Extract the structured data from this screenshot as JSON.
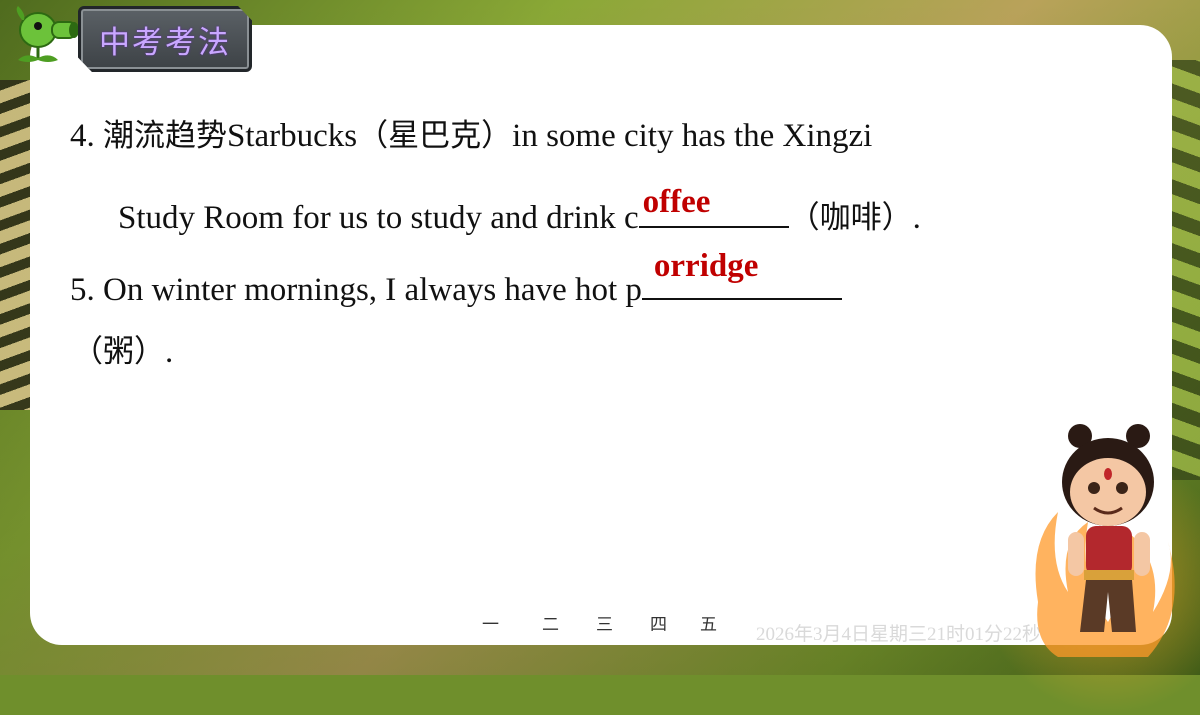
{
  "badge": {
    "title": "中考考法"
  },
  "questions": [
    {
      "number": "4.",
      "topic": "潮流趋势",
      "text_a": "Starbucks",
      "gloss_a": "（星巴克）",
      "text_b": "in some city has the Xingzi",
      "text_c": "Study Room for us to study and drink c",
      "answer": "offee",
      "gloss_b": "（咖啡）",
      "end": "."
    },
    {
      "number": "5.",
      "text_a": "On winter mornings, I always have hot p",
      "answer": "orridge",
      "gloss": "（粥）",
      "end": "."
    }
  ],
  "nav": [
    "一",
    "二",
    "三",
    "四",
    "五"
  ],
  "watermark": "2026年3月4日星期三21时01分22秒",
  "colors": {
    "answer": "#c00000",
    "badge_text": "#c9a7ff",
    "card": "#ffffff"
  },
  "icons": [
    "peashooter-icon",
    "nezha-character-icon"
  ]
}
